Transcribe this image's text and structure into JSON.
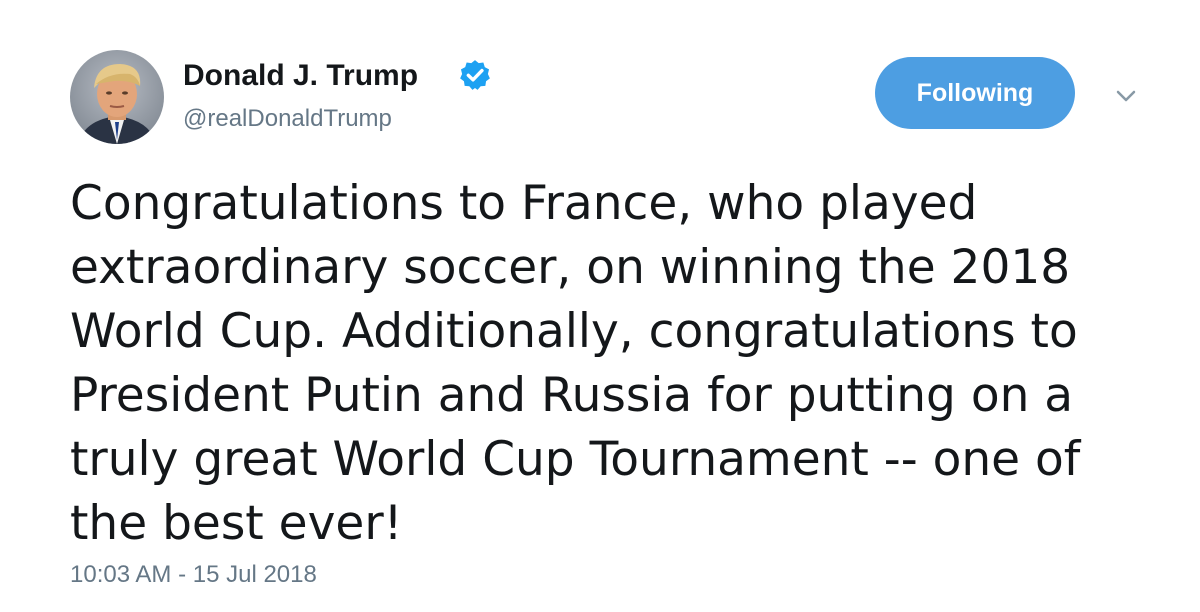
{
  "author": {
    "display_name": "Donald J. Trump",
    "handle": "@realDonaldTrump",
    "verified": true,
    "avatar_icon": "profile-photo"
  },
  "follow_button": {
    "label": "Following",
    "color": "#4d9ee2"
  },
  "menu": {
    "icon": "chevron-down-icon"
  },
  "tweet": {
    "text_lines": [
      "Congratulations to France, who played",
      "extraordinary soccer, on winning the 2018",
      "World Cup. Additionally, congratulations to",
      "President Putin and Russia for putting on a",
      "truly great World Cup Tournament -- one of",
      "the best ever!"
    ],
    "timestamp": "10:03 AM - 15 Jul 2018"
  },
  "colors": {
    "text": "#14171a",
    "secondary_text": "#657786",
    "verified_badge": "#1da1f2"
  }
}
